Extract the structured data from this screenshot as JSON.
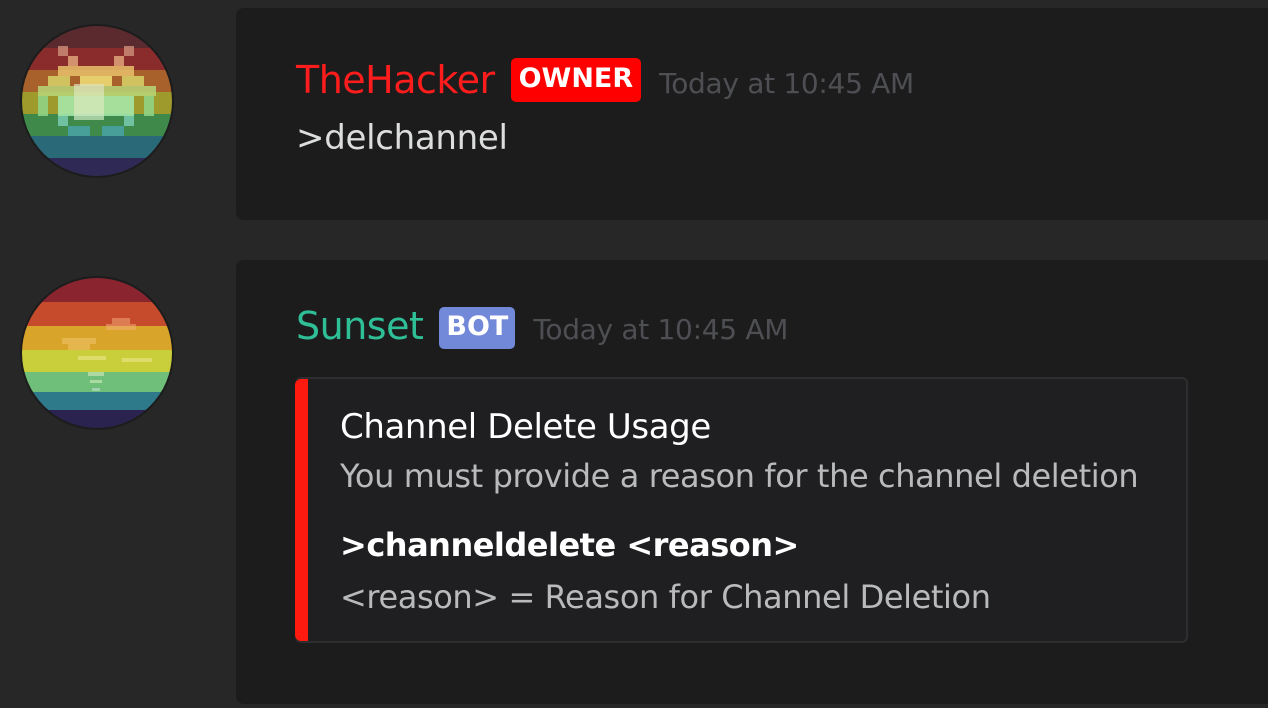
{
  "messages": [
    {
      "avatar_icon": "space-invader-avatar-icon",
      "username": "TheHacker",
      "username_color": "#ff1c1c",
      "badge": "OWNER",
      "badge_color": "#ff0000",
      "timestamp": "Today at 10:45 AM",
      "content": ">delchannel"
    },
    {
      "avatar_icon": "sunset-avatar-icon",
      "username": "Sunset",
      "username_color": "#2fbf97",
      "badge": "BOT",
      "badge_color": "#7289da",
      "timestamp": "Today at 10:45 AM",
      "embed": {
        "color": "#ff1a0f",
        "title": "Channel Delete Usage",
        "description": "You must provide a reason for the channel deletion",
        "field_name": ">channeldelete <reason>",
        "field_value": "<reason> = Reason for Channel Deletion"
      }
    }
  ]
}
